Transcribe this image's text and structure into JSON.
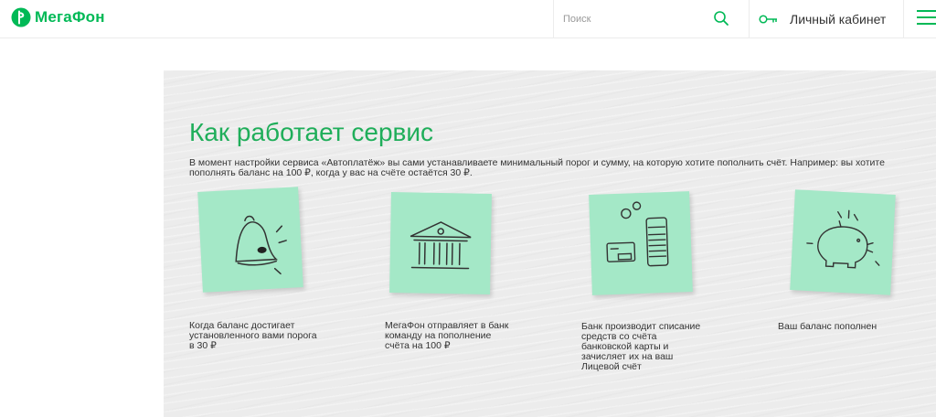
{
  "header": {
    "logo_text": "МегаФон",
    "search_placeholder": "Поиск",
    "account_label": "Личный кабинет"
  },
  "section": {
    "title": "Как работает сервис",
    "description": "В момент настройки сервиса «Автоплатёж» вы сами устанавливаете минимальный порог и сумму, на которую хотите пополнить счёт. Например: вы хотите пополнять баланс на 100 ₽, когда у вас на счёте остаётся 30 ₽."
  },
  "steps": [
    {
      "icon": "bell-icon",
      "text": "Когда баланс достигает установленного вами порога в 30 ₽"
    },
    {
      "icon": "bank-icon",
      "text": "МегаФон отправляет в банк команду на пополнение счёта на 100 ₽"
    },
    {
      "icon": "card-coins-icon",
      "text": "Банк производит списание средств со счёта банковской карты и зачисляет их на ваш Лицевой счёт"
    },
    {
      "icon": "piggy-bank-icon",
      "text": "Ваш баланс пополнен"
    }
  ],
  "colors": {
    "brand": "#00b956",
    "note": "#a4e8c7"
  }
}
